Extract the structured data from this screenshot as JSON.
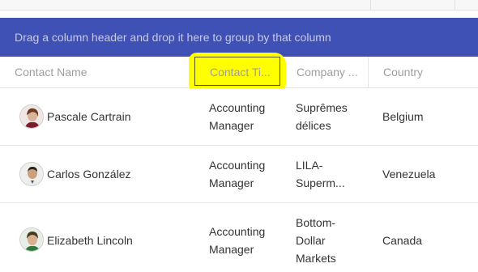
{
  "group_panel": {
    "text": "Drag a column header and drop it here to group by that column"
  },
  "columns": [
    {
      "label": "Contact Name"
    },
    {
      "label": "Contact Ti..."
    },
    {
      "label": "Company ..."
    },
    {
      "label": "Country"
    }
  ],
  "rows": [
    {
      "name": "Pascale Cartrain",
      "title": [
        "Accounting",
        "Manager"
      ],
      "company": [
        "Suprêmes",
        "délices"
      ],
      "country": "Belgium"
    },
    {
      "name": "Carlos González",
      "title": [
        "Accounting",
        "Manager"
      ],
      "company": [
        "LILA-",
        "Superm..."
      ],
      "country": "Venezuela"
    },
    {
      "name": "Elizabeth Lincoln",
      "title": [
        "Accounting",
        "Manager"
      ],
      "company": [
        "Bottom-",
        "Dollar",
        "Markets"
      ],
      "country": "Canada"
    }
  ],
  "colors": {
    "accent": "#3f51b5",
    "highlight": "#ffff00"
  }
}
